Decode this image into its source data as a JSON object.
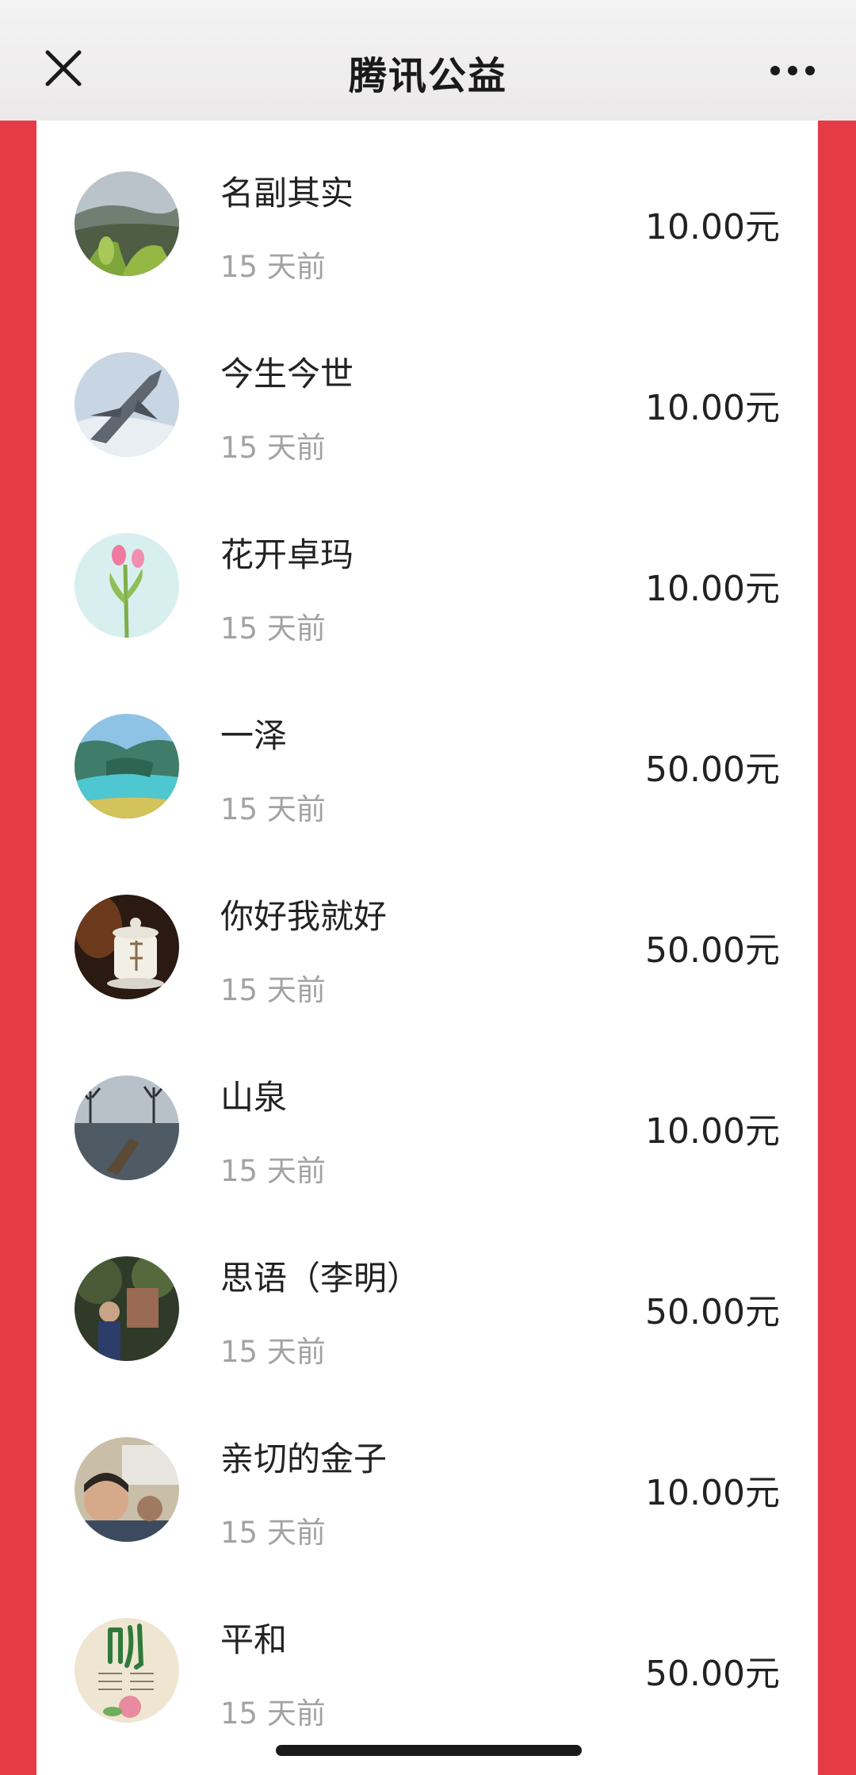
{
  "header": {
    "title": "腾讯公益",
    "close_icon": "close-icon",
    "more_icon": "more-icon"
  },
  "colors": {
    "background_accent": "#E63B45",
    "panel": "#FFFFFF",
    "text_primary": "#222222",
    "text_secondary": "#A3A3A3"
  },
  "donors": [
    {
      "name": "名副其实",
      "time": "15 天前",
      "amount": "10.00元",
      "avatar": "tea-hills-avatar"
    },
    {
      "name": "今生今世",
      "time": "15 天前",
      "amount": "10.00元",
      "avatar": "jet-avatar"
    },
    {
      "name": "花开卓玛",
      "time": "15 天前",
      "amount": "10.00元",
      "avatar": "tulip-avatar"
    },
    {
      "name": "一泽",
      "time": "15 天前",
      "amount": "50.00元",
      "avatar": "river-gorge-avatar"
    },
    {
      "name": "你好我就好",
      "time": "15 天前",
      "amount": "50.00元",
      "avatar": "tea-cup-avatar"
    },
    {
      "name": "山泉",
      "time": "15 天前",
      "amount": "10.00元",
      "avatar": "lake-boat-avatar"
    },
    {
      "name": "思语（李明）",
      "time": "15 天前",
      "amount": "50.00元",
      "avatar": "forest-person-avatar"
    },
    {
      "name": "亲切的金子",
      "time": "15 天前",
      "amount": "10.00元",
      "avatar": "child-avatar"
    },
    {
      "name": "平和",
      "time": "15 天前",
      "amount": "50.00元",
      "avatar": "calligraphy-avatar"
    }
  ]
}
